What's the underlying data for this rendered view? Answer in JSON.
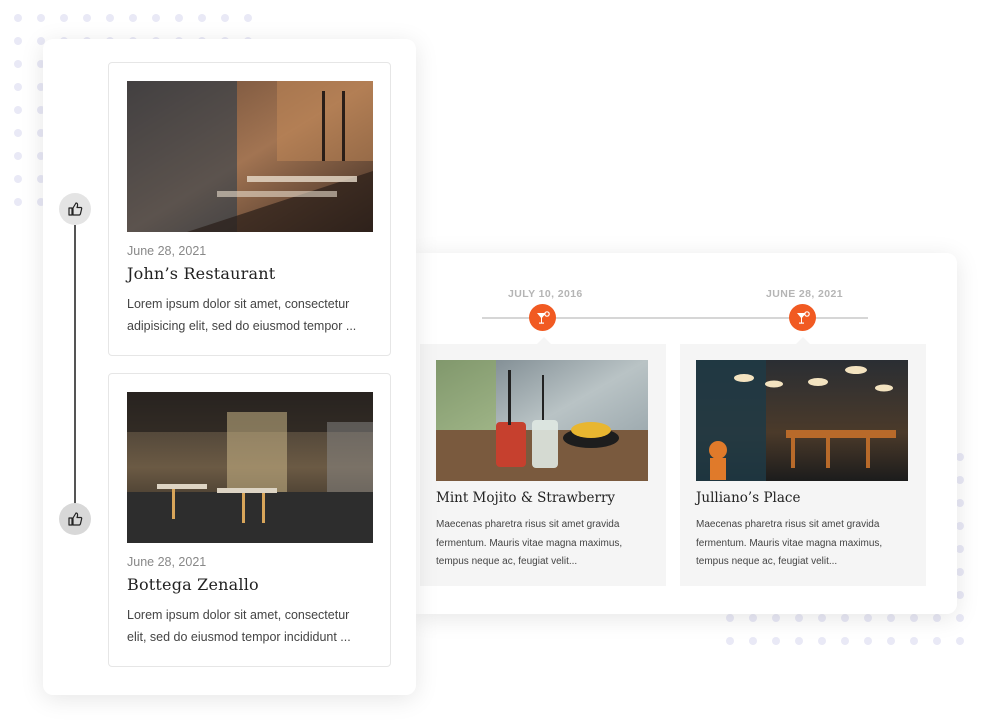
{
  "vertical_timeline": {
    "items": [
      {
        "date": "June 28, 2021",
        "title": "John’s Restaurant",
        "text": "Lorem ipsum dolor sit amet, consectetur adipisicing elit, sed do eiusmod tempor ...",
        "icon": "thumbs-up-icon"
      },
      {
        "date": "June 28, 2021",
        "title": "Bottega Zenallo",
        "text": "Lorem ipsum dolor sit amet, consectetur elit, sed do eiusmod tempor incididunt ...",
        "icon": "thumbs-up-icon"
      }
    ]
  },
  "horizontal_timeline": {
    "accent_color": "#f15a22",
    "items": [
      {
        "date": "JULY 10, 2016",
        "title": "Mint Mojito & Strawberry",
        "text": "Maecenas pharetra risus sit amet gravida fermentum. Mauris vitae magna maximus, tempus neque ac, feugiat velit...",
        "icon": "cocktail-icon"
      },
      {
        "date": "JUNE 28, 2021",
        "title": "Julliano’s Place",
        "text": "Maecenas pharetra risus sit amet gravida fermentum. Mauris vitae magna maximus, tempus neque ac, feugiat velit...",
        "icon": "cocktail-icon"
      }
    ]
  }
}
